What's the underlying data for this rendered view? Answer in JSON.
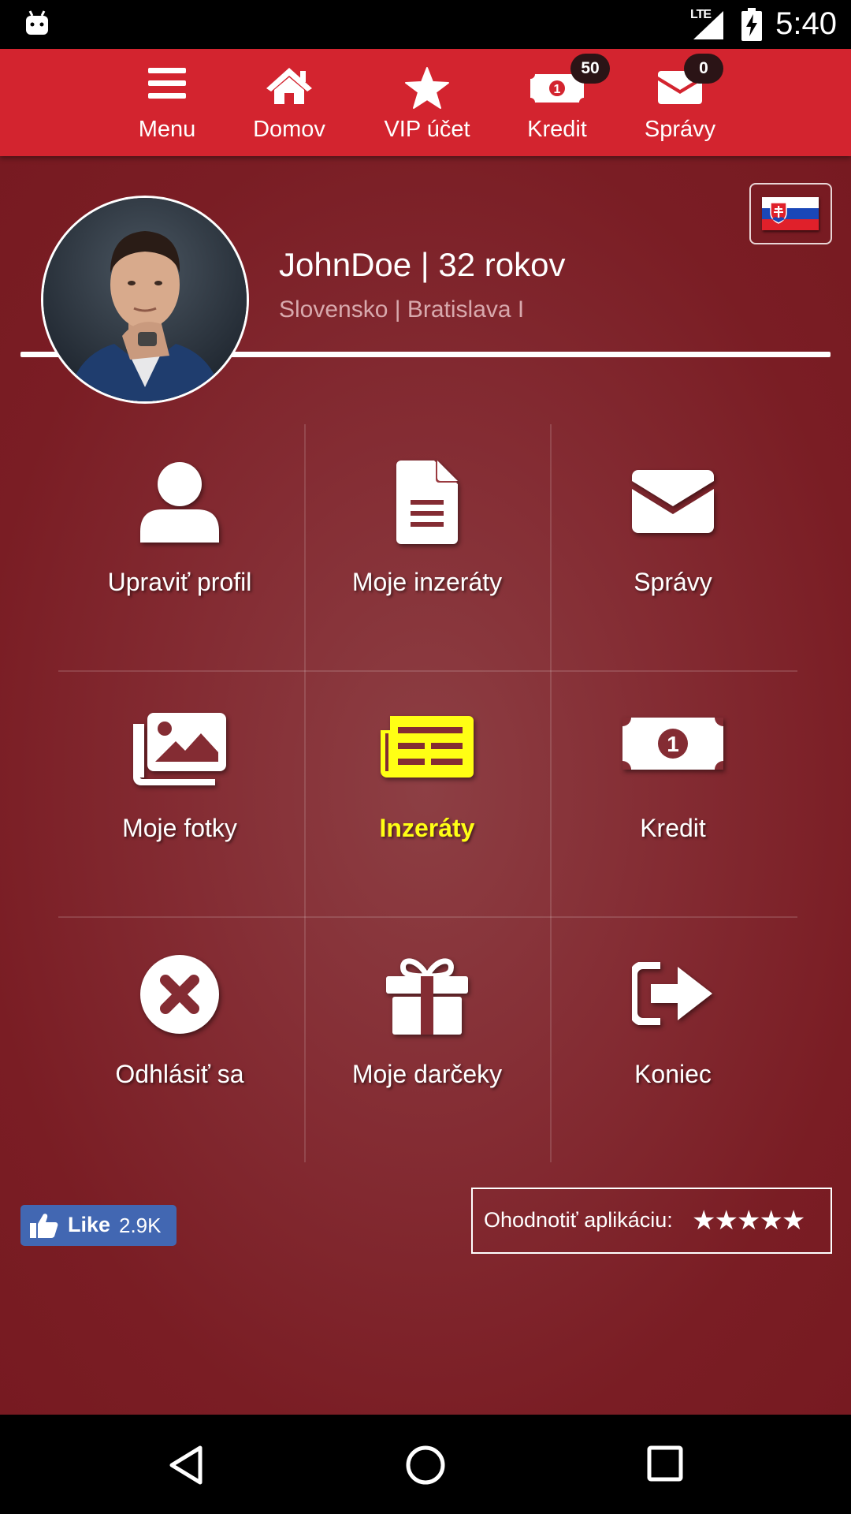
{
  "status_bar": {
    "network": "LTE",
    "time": "5:40"
  },
  "top_nav": {
    "items": [
      {
        "label": "Menu",
        "icon": "menu-icon"
      },
      {
        "label": "Domov",
        "icon": "home-icon"
      },
      {
        "label": "VIP účet",
        "icon": "star-icon"
      },
      {
        "label": "Kredit",
        "icon": "money-icon",
        "badge": "50"
      },
      {
        "label": "Správy",
        "icon": "envelope-icon",
        "badge": "0"
      }
    ]
  },
  "profile": {
    "name_age": "JohnDoe | 32 rokov",
    "location": "Slovensko | Bratislava I",
    "language_flag": "slovak-flag-icon"
  },
  "grid": {
    "tiles": [
      {
        "label": "Upraviť profil",
        "icon": "user-icon"
      },
      {
        "label": "Moje inzeráty",
        "icon": "document-icon"
      },
      {
        "label": "Správy",
        "icon": "envelope-icon"
      },
      {
        "label": "Moje fotky",
        "icon": "photos-icon"
      },
      {
        "label": "Inzeráty",
        "icon": "listing-icon",
        "active": true
      },
      {
        "label": "Kredit",
        "icon": "money-icon"
      },
      {
        "label": "Odhlásiť sa",
        "icon": "close-circle-icon"
      },
      {
        "label": "Moje darčeky",
        "icon": "gift-icon"
      },
      {
        "label": "Koniec",
        "icon": "exit-icon"
      }
    ]
  },
  "footer": {
    "like_label": "Like",
    "like_count": "2.9K",
    "rate_label": "Ohodnotiť aplikáciu:",
    "rate_stars": "★★★★★"
  },
  "colors": {
    "nav_red": "#d3242f",
    "bg_maroon": "#842c33",
    "active_yellow": "#ffff14",
    "facebook_blue": "#4267b2"
  }
}
